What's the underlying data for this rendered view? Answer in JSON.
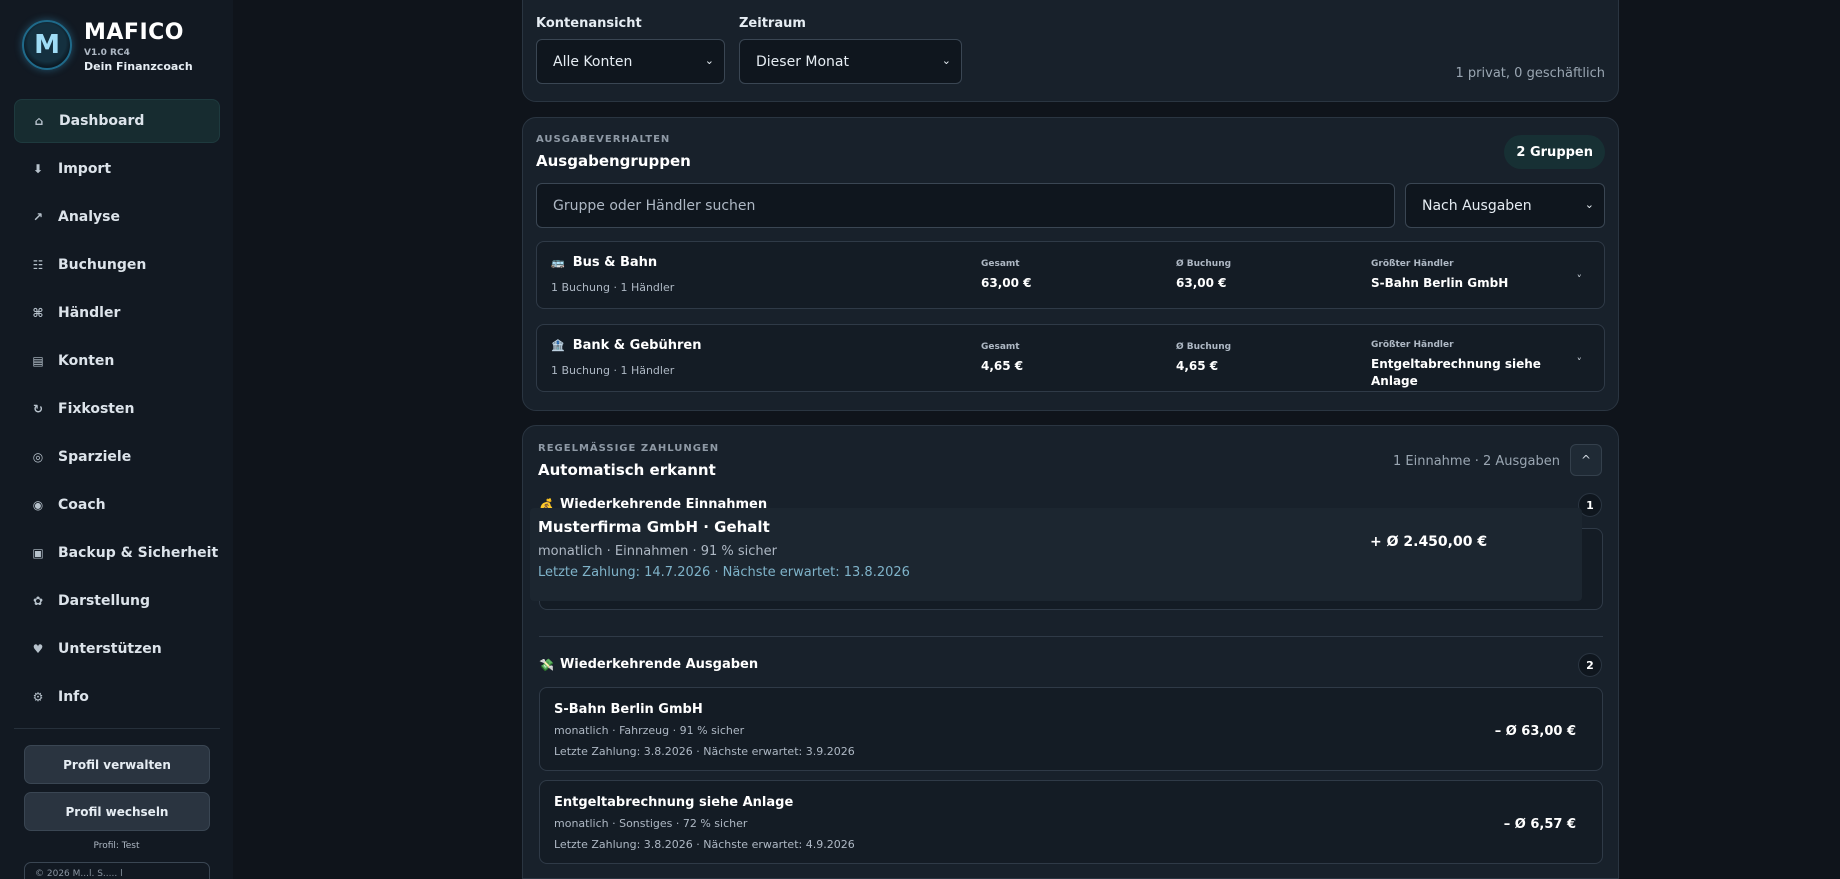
{
  "app": {
    "name": "MAFICO",
    "version": "V1.0 RC4",
    "slogan": "Dein Finanzcoach",
    "logo_letter": "M"
  },
  "sidebar": {
    "items": [
      {
        "label": "Dashboard",
        "icon": "⌂",
        "active": true
      },
      {
        "label": "Import",
        "icon": "⬇"
      },
      {
        "label": "Analyse",
        "icon": "↗"
      },
      {
        "label": "Buchungen",
        "icon": "☷"
      },
      {
        "label": "Händler",
        "icon": "⌘"
      },
      {
        "label": "Konten",
        "icon": "▤"
      },
      {
        "label": "Fixkosten",
        "icon": "↻"
      },
      {
        "label": "Sparziele",
        "icon": "◎"
      },
      {
        "label": "Coach",
        "icon": "◉"
      },
      {
        "label": "Backup & Sicherheit",
        "icon": "▣"
      },
      {
        "label": "Darstellung",
        "icon": "✿"
      },
      {
        "label": "Unterstützen",
        "icon": "♥"
      },
      {
        "label": "Info",
        "icon": "⚙"
      }
    ],
    "manage_profile": "Profil verwalten",
    "switch_profile": "Profil wechseln",
    "profile_label": "Profil: Test",
    "copyright": "© 2026 M...l. S..... l"
  },
  "filters": {
    "account_label": "Kontenansicht",
    "account_value": "Alle Konten",
    "period_label": "Zeitraum",
    "period_value": "Dieser Monat",
    "summary": "1 privat, 0 geschäftlich"
  },
  "spending": {
    "eyebrow": "AUSGABEVERHALTEN",
    "title": "Ausgabengruppen",
    "count_badge": "2 Gruppen",
    "search_placeholder": "Gruppe oder Händler suchen",
    "sort_value": "Nach Ausgaben",
    "stat_labels": {
      "total": "Gesamt",
      "avg": "Ø Buchung",
      "top": "Größter Händler"
    },
    "groups": [
      {
        "name": "Bus & Bahn",
        "icon": "🚌",
        "sub": "1 Buchung · 1 Händler",
        "total": "63,00 €",
        "avg": "63,00 €",
        "top_merchant": "S-Bahn Berlin GmbH"
      },
      {
        "name": "Bank & Gebühren",
        "icon": "🏦",
        "sub": "1 Buchung · 1 Händler",
        "total": "4,65 €",
        "avg": "4,65 €",
        "top_merchant": "Entgeltabrechnung siehe Anlage"
      }
    ]
  },
  "recurring": {
    "eyebrow": "REGELMÄSSIGE ZAHLUNGEN",
    "title": "Automatisch erkannt",
    "summary": "1 Einnahme · 2 Ausgaben",
    "collapse_icon": "^",
    "income_title": "Wiederkehrende Einnahmen",
    "income_icon": "💰",
    "income_count": "1",
    "income": [
      {
        "name": "Musterfirma GmbH · Gehalt",
        "sub": "monatlich · Einnahmen · 91 % sicher",
        "dates": "Letzte Zahlung: 14.7.2026 · Nächste erwartet: 13.8.2026",
        "amount": "+ Ø 2.450,00 €"
      }
    ],
    "expense_title": "Wiederkehrende Ausgaben",
    "expense_icon": "💸",
    "expense_count": "2",
    "expenses": [
      {
        "name": "S-Bahn Berlin GmbH",
        "sub": "monatlich · Fahrzeug · 91 % sicher",
        "dates": "Letzte Zahlung: 3.8.2026 · Nächste erwartet: 3.9.2026",
        "amount": "– Ø 63,00 €"
      },
      {
        "name": "Entgeltabrechnung siehe Anlage",
        "sub": "monatlich · Sonstiges · 72 % sicher",
        "dates": "Letzte Zahlung: 3.8.2026 · Nächste erwartet: 4.9.2026",
        "amount": "– Ø 6,57 €"
      }
    ]
  }
}
